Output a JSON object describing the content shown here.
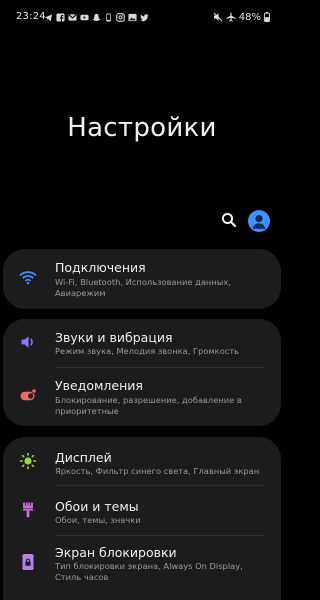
{
  "status_bar": {
    "time": "23:24",
    "battery": "48%",
    "left_icons": [
      "telegram-icon",
      "facebook-icon",
      "gmail-icon",
      "youtube-icon",
      "snapchat-icon",
      "phone-icon",
      "instagram-icon",
      "gallery-icon",
      "twitter-icon"
    ],
    "right_icons": [
      "mute-icon",
      "airplane-icon",
      "battery-icon"
    ]
  },
  "header": {
    "title": "Настройки"
  },
  "accent_color": "#3e91ff",
  "sections": [
    {
      "items": [
        {
          "title": "Подключения",
          "subtitle": "Wi-Fi, Bluetooth, Использование данных, Авиарежим",
          "icon": "wifi-icon",
          "icon_color": "#3e91ff"
        }
      ]
    },
    {
      "items": [
        {
          "title": "Звуки и вибрация",
          "subtitle": "Режим звука, Мелодия звонка, Громкость",
          "icon": "volume-icon",
          "icon_color": "#8b7df5"
        },
        {
          "title": "Уведомления",
          "subtitle": "Блокирование, разрешение, добавление в приоритетные",
          "icon": "notification-icon",
          "icon_color": "#f06a5f"
        }
      ]
    },
    {
      "items": [
        {
          "title": "Дисплей",
          "subtitle": "Яркость, Фильтр синего света, Главный экран",
          "icon": "brightness-icon",
          "icon_color": "#9bd64c"
        },
        {
          "title": "Обои и темы",
          "subtitle": "Обои, темы, значки",
          "icon": "brush-icon",
          "icon_color": "#c86cd8"
        },
        {
          "title": "Экран блокировки",
          "subtitle": "Тип блокировки экрана, Always On Display, Стиль часов",
          "icon": "lock-screen-icon",
          "icon_color": "#b682e8"
        }
      ]
    }
  ]
}
